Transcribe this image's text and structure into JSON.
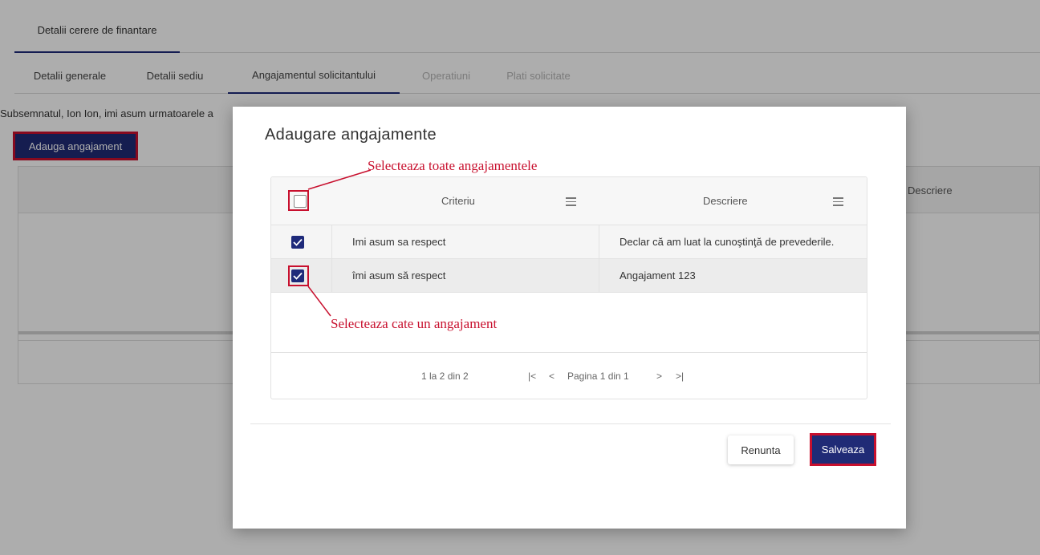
{
  "page": {
    "top_tab": "Detalii cerere de finantare",
    "sub_tabs": [
      {
        "label": "Detalii generale",
        "state": "normal"
      },
      {
        "label": "Detalii sediu",
        "state": "normal"
      },
      {
        "label": "Angajamentul solicitantului",
        "state": "active"
      },
      {
        "label": "Operatiuni",
        "state": "disabled"
      },
      {
        "label": "Plati solicitate",
        "state": "disabled"
      }
    ],
    "intro_text": "Subsemnatul, Ion Ion, imi asum urmatoarele a",
    "add_button": "Adauga angajament",
    "bg_table_header": "Descriere"
  },
  "modal": {
    "title": "Adaugare angajamente",
    "columns": {
      "criteriu": "Criteriu",
      "descriere": "Descriere"
    },
    "rows": [
      {
        "checked": true,
        "criteriu": "Imi asum sa respect",
        "descriere": "Declar că am luat la cunoştinţă de prevederile."
      },
      {
        "checked": true,
        "criteriu": "îmi asum să respect",
        "descriere": "Angajament 123"
      }
    ],
    "pager": {
      "summary": "1 la 2 din 2",
      "first": "|<",
      "prev": "<",
      "page": "Pagina 1 din 1",
      "next": ">",
      "last": ">|"
    },
    "cancel_button": "Renunta",
    "save_button": "Salveaza"
  },
  "annotations": {
    "select_all": "Selecteaza toate angajamentele",
    "select_one": "Selecteaza cate un angajament"
  },
  "colors": {
    "primary": "#202b76",
    "highlight": "#c8102e"
  }
}
